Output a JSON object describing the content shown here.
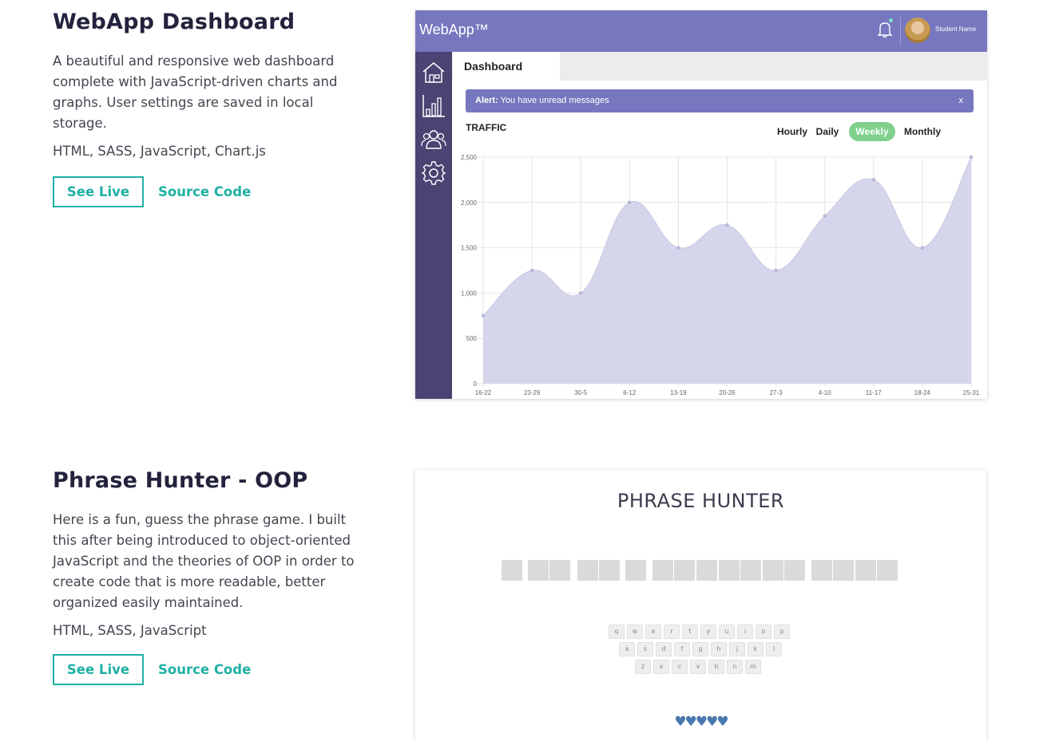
{
  "projects": [
    {
      "title": "WebApp Dashboard",
      "description": "A beautiful and responsive web dashboard complete with JavaScript-driven charts and graphs. User settings are saved in local storage.",
      "tech": "HTML, SASS, JavaScript, Chart.js",
      "see_live": "See Live",
      "source_code": "Source Code"
    },
    {
      "title": "Phrase Hunter - OOP",
      "description": "Here is a fun, guess the phrase game. I built this after being introduced to object-oriented JavaScript and the theories of OOP in order to create code that is more readable, better organized easily maintained.",
      "tech": "HTML, SASS, JavaScript",
      "see_live": "See Live",
      "source_code": "Source Code"
    }
  ],
  "dashboard_preview": {
    "logo": "WebApp™",
    "user_name": "Student Name",
    "tab": "Dashboard",
    "alert_label": "Alert:",
    "alert_text": "You have unread messages",
    "alert_close": "x",
    "section_title": "TRAFFIC",
    "ranges": [
      "Hourly",
      "Daily",
      "Weekly",
      "Monthly"
    ],
    "selected_range": "Weekly",
    "colors": {
      "header": "#7777bf",
      "sidebar": "#4c4373",
      "selected_range": "#7ed08a",
      "area_fill": "#d5d5eb"
    }
  },
  "chart_data": {
    "type": "area",
    "categories": [
      "16-22",
      "23-29",
      "30-5",
      "6-12",
      "13-19",
      "20-26",
      "27-3",
      "4-10",
      "11-17",
      "18-24",
      "25-31"
    ],
    "values": [
      750,
      1250,
      1000,
      2000,
      1500,
      1750,
      1250,
      1850,
      2250,
      1500,
      2500
    ],
    "y_ticks": [
      "0",
      "500",
      "1,000",
      "1,500",
      "2,000",
      "2,500"
    ],
    "ylim": [
      0,
      2500
    ],
    "grid": true
  },
  "phrase_hunter_preview": {
    "title": "PHRASE HUNTER",
    "keyboard_rows": [
      [
        "q",
        "w",
        "e",
        "r",
        "t",
        "y",
        "u",
        "i",
        "o",
        "p"
      ],
      [
        "a",
        "s",
        "d",
        "f",
        "g",
        "h",
        "j",
        "k",
        "l"
      ],
      [
        "z",
        "x",
        "c",
        "v",
        "b",
        "n",
        "m"
      ]
    ],
    "hearts": "♥♥♥♥♥"
  }
}
